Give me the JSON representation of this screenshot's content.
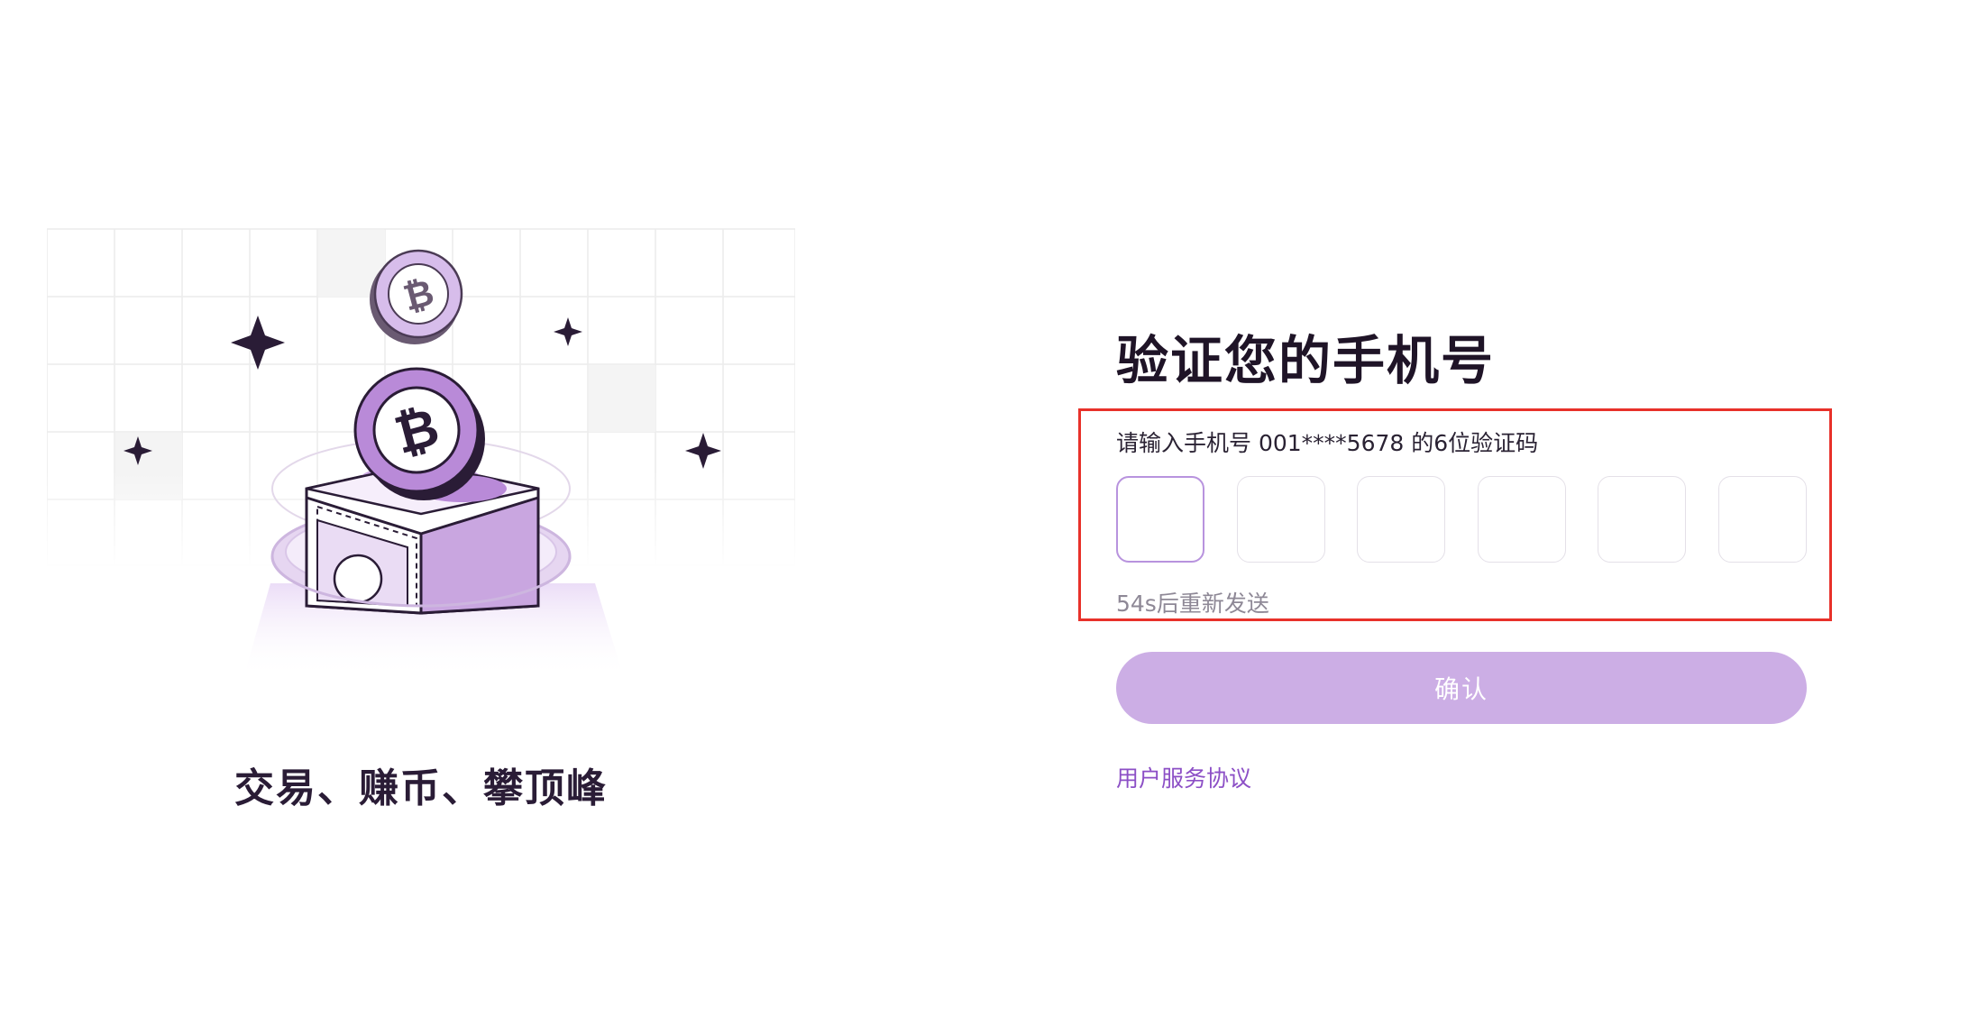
{
  "illustration": {
    "tagline": "交易、赚币、攀顶峰"
  },
  "form": {
    "title": "验证您的手机号",
    "instruction": "请输入手机号 001****5678 的6位验证码",
    "otp_cells": [
      "",
      "",
      "",
      "",
      "",
      ""
    ],
    "resend_text": "54s后重新发送",
    "confirm_label": "确认",
    "agreement_link": "用户服务协议"
  },
  "colors": {
    "accent": "#8c4fc6",
    "button_disabled": "#ccaee5",
    "highlight_border": "#e8312a",
    "title": "#1f1427"
  },
  "icons": [
    "bitcoin-coin-icon",
    "sparkle-icon",
    "vault-box-icon"
  ]
}
